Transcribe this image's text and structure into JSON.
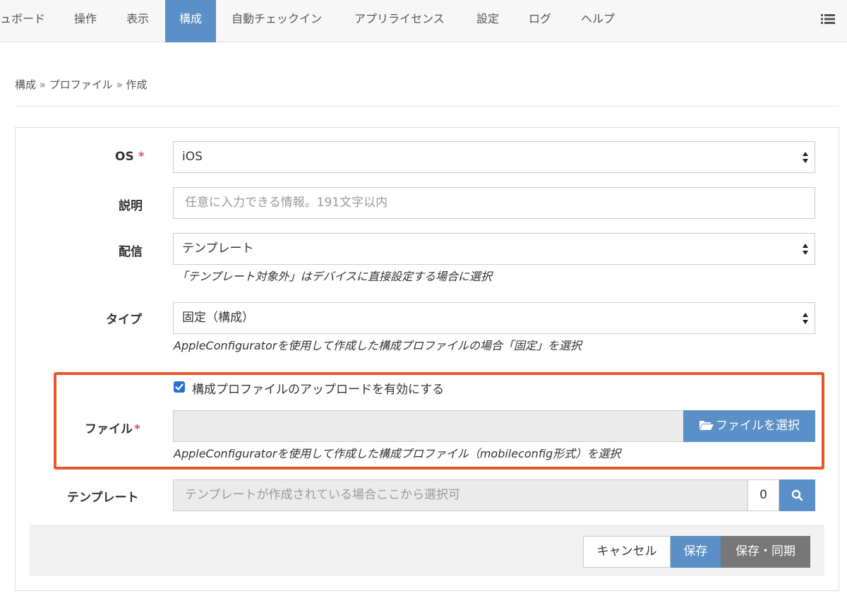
{
  "nav": {
    "items": [
      {
        "label": "ュボード"
      },
      {
        "label": "操作"
      },
      {
        "label": "表示"
      },
      {
        "label": "構成"
      },
      {
        "label": "自動チェックイン"
      },
      {
        "label": "アプリライセンス"
      },
      {
        "label": "設定"
      },
      {
        "label": "ログ"
      },
      {
        "label": "ヘルプ"
      }
    ],
    "active_index": 3,
    "menu_icon": "list-menu-icon"
  },
  "breadcrumb": {
    "items": [
      "構成",
      "プロファイル",
      "作成"
    ],
    "separator": "»"
  },
  "form": {
    "os": {
      "label": "OS",
      "required_mark": "*",
      "value": "iOS"
    },
    "description": {
      "label": "説明",
      "placeholder": "任意に入力できる情報。191文字以内"
    },
    "delivery": {
      "label": "配信",
      "value": "テンプレート",
      "hint": "「テンプレート対象外」はデバイスに直接設定する場合に選択"
    },
    "type": {
      "label": "タイプ",
      "value": "固定（構成）",
      "hint": "AppleConfiguratorを使用して作成した構成プロファイルの場合「固定」を選択"
    },
    "upload": {
      "checkbox_label": "構成プロファイルのアップロードを有効にする",
      "checked": true
    },
    "file": {
      "label": "ファイル",
      "required_mark": "*",
      "button_label": "ファイルを選択",
      "hint": "AppleConfiguratorを使用して作成した構成プロファイル（mobileconfig形式）を選択"
    },
    "template": {
      "label": "テンプレート",
      "placeholder": "テンプレートが作成されている場合ここから選択可",
      "count": "0"
    }
  },
  "actions": {
    "cancel": "キャンセル",
    "save": "保存",
    "save_sync": "保存・同期"
  },
  "colors": {
    "accent": "#5b8fc7",
    "highlight_border": "#e8572a",
    "required": "#d9534f",
    "secondary_button": "#777777"
  }
}
